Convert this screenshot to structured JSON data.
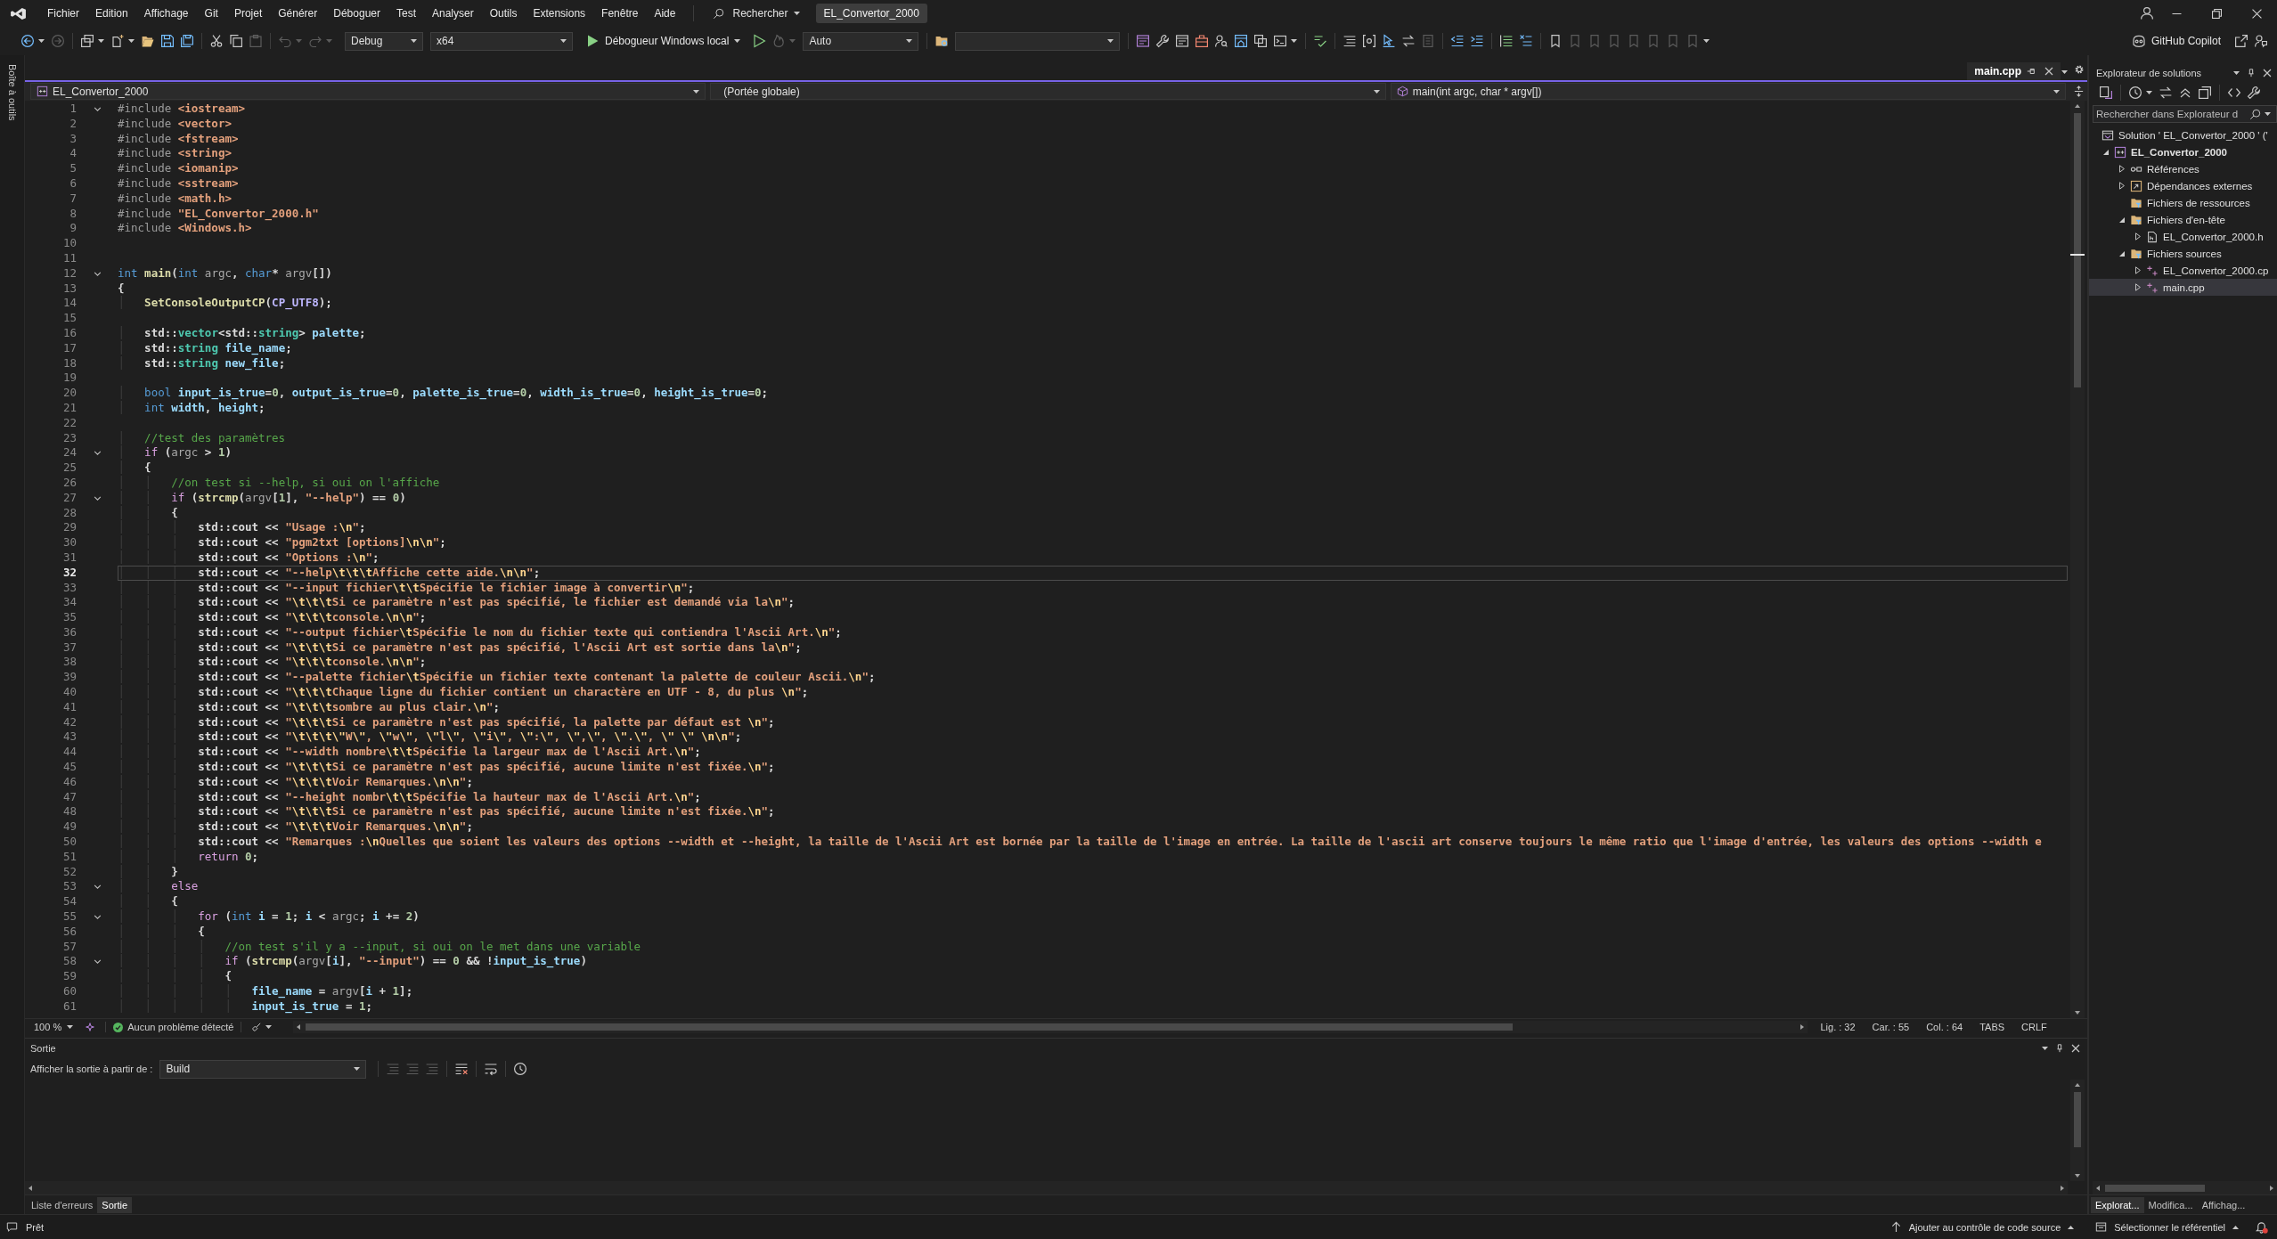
{
  "menu_bar": {
    "items": [
      "Fichier",
      "Edition",
      "Affichage",
      "Git",
      "Projet",
      "Générer",
      "Déboguer",
      "Test",
      "Analyser",
      "Outils",
      "Extensions",
      "Fenêtre",
      "Aide"
    ],
    "search": "Rechercher",
    "solution_name": "EL_Convertor_2000"
  },
  "toolbar": {
    "configuration": "Debug",
    "platform": "x64",
    "start": "Débogueur Windows local",
    "mode": "Auto",
    "copilot": "GitHub Copilot"
  },
  "side_strip": {
    "label": "Boîte à outils"
  },
  "editor": {
    "tabs": [
      {
        "label": "main.cpp",
        "selected": true
      }
    ],
    "navigation": {
      "project": "EL_Convertor_2000",
      "scope": "(Portée globale)",
      "member": "main(int argc, char * argv[])"
    },
    "lines": [
      {
        "number": "1",
        "fold": true,
        "current": false,
        "tokens": [
          {
            "kind": "preproc",
            "text": "#include "
          },
          {
            "kind": "include",
            "text": "<iostream>"
          }
        ]
      },
      {
        "number": "2",
        "fold": false,
        "current": false,
        "tokens": [
          {
            "kind": "preproc",
            "text": "#include "
          },
          {
            "kind": "include",
            "text": "<vector>"
          }
        ]
      },
      {
        "number": "3",
        "fold": false,
        "current": false,
        "tokens": [
          {
            "kind": "preproc",
            "text": "#include "
          },
          {
            "kind": "include",
            "text": "<fstream>"
          }
        ]
      },
      {
        "number": "4",
        "fold": false,
        "current": false,
        "tokens": [
          {
            "kind": "preproc",
            "text": "#include "
          },
          {
            "kind": "include",
            "text": "<string>"
          }
        ]
      },
      {
        "number": "5",
        "fold": false,
        "current": false,
        "tokens": [
          {
            "kind": "preproc",
            "text": "#include "
          },
          {
            "kind": "include",
            "text": "<iomanip>"
          }
        ]
      },
      {
        "number": "6",
        "fold": false,
        "current": false,
        "tokens": [
          {
            "kind": "preproc",
            "text": "#include "
          },
          {
            "kind": "include",
            "text": "<sstream>"
          }
        ]
      },
      {
        "number": "7",
        "fold": false,
        "current": false,
        "tokens": [
          {
            "kind": "preproc",
            "text": "#include "
          },
          {
            "kind": "include",
            "text": "<math.h>"
          }
        ]
      },
      {
        "number": "8",
        "fold": false,
        "current": false,
        "tokens": [
          {
            "kind": "preproc",
            "text": "#include "
          },
          {
            "kind": "include",
            "text": "\"EL_Convertor_2000.h\""
          }
        ]
      },
      {
        "number": "9",
        "fold": false,
        "current": false,
        "tokens": [
          {
            "kind": "preproc",
            "text": "#include "
          },
          {
            "kind": "include",
            "text": "<Windows.h>"
          }
        ]
      },
      {
        "number": "10",
        "fold": false,
        "current": false
      },
      {
        "number": "11",
        "fold": false,
        "current": false
      },
      {
        "number": "12",
        "fold": true,
        "current": false,
        "tokens": [
          {
            "kind": "kw",
            "text": "int "
          },
          {
            "kind": "fn",
            "text": "main"
          },
          {
            "kind": "plain",
            "text": "("
          },
          {
            "kind": "kw",
            "text": "int "
          },
          {
            "kind": "param",
            "text": "argc"
          },
          {
            "kind": "plain",
            "text": ", "
          },
          {
            "kind": "kw",
            "text": "char"
          },
          {
            "kind": "plain",
            "text": "* "
          },
          {
            "kind": "param",
            "text": "argv"
          },
          {
            "kind": "plain",
            "text": "[])"
          }
        ]
      },
      {
        "number": "13",
        "fold": false,
        "current": false,
        "tokens": [
          {
            "kind": "plain",
            "text": "{"
          }
        ]
      },
      {
        "number": "14",
        "fold": false,
        "current": false,
        "tokens": [
          {
            "kind": "fn",
            "text": "\tSetConsoleOutputCP"
          },
          {
            "kind": "plain",
            "text": "("
          },
          {
            "kind": "macro",
            "text": "CP_UTF8"
          },
          {
            "kind": "plain",
            "text": ");"
          }
        ]
      },
      {
        "number": "15",
        "fold": false,
        "current": false
      },
      {
        "number": "16",
        "fold": false,
        "current": false,
        "tokens": [
          {
            "kind": "plain",
            "text": "\tstd::"
          },
          {
            "kind": "type",
            "text": "vector"
          },
          {
            "kind": "plain",
            "text": "<std::"
          },
          {
            "kind": "type",
            "text": "string"
          },
          {
            "kind": "plain",
            "text": "> "
          },
          {
            "kind": "var",
            "text": "palette"
          },
          {
            "kind": "plain",
            "text": ";"
          }
        ]
      },
      {
        "number": "17",
        "fold": false,
        "current": false,
        "tokens": [
          {
            "kind": "plain",
            "text": "\tstd::"
          },
          {
            "kind": "type",
            "text": "string"
          },
          {
            "kind": "var",
            "text": " file_name"
          },
          {
            "kind": "plain",
            "text": ";"
          }
        ]
      },
      {
        "number": "18",
        "fold": false,
        "current": false,
        "tokens": [
          {
            "kind": "plain",
            "text": "\tstd::"
          },
          {
            "kind": "type",
            "text": "string"
          },
          {
            "kind": "var",
            "text": " new_file"
          },
          {
            "kind": "plain",
            "text": ";"
          }
        ]
      },
      {
        "number": "19",
        "fold": false,
        "current": false
      },
      {
        "number": "20",
        "fold": false,
        "current": false,
        "tokens": [
          {
            "kind": "kw",
            "text": "\tbool "
          },
          {
            "kind": "var",
            "text": "input_is_true"
          },
          {
            "kind": "plain",
            "text": "="
          },
          {
            "kind": "num",
            "text": "0"
          },
          {
            "kind": "plain",
            "text": ", "
          },
          {
            "kind": "var",
            "text": "output_is_true"
          },
          {
            "kind": "plain",
            "text": "="
          },
          {
            "kind": "num",
            "text": "0"
          },
          {
            "kind": "plain",
            "text": ", "
          },
          {
            "kind": "var",
            "text": "palette_is_true"
          },
          {
            "kind": "plain",
            "text": "="
          },
          {
            "kind": "num",
            "text": "0"
          },
          {
            "kind": "plain",
            "text": ", "
          },
          {
            "kind": "var",
            "text": "width_is_true"
          },
          {
            "kind": "plain",
            "text": "="
          },
          {
            "kind": "num",
            "text": "0"
          },
          {
            "kind": "plain",
            "text": ", "
          },
          {
            "kind": "var",
            "text": "height_is_true"
          },
          {
            "kind": "plain",
            "text": "="
          },
          {
            "kind": "num",
            "text": "0"
          },
          {
            "kind": "plain",
            "text": ";"
          }
        ]
      },
      {
        "number": "21",
        "fold": false,
        "current": false,
        "tokens": [
          {
            "kind": "kw",
            "text": "\tint "
          },
          {
            "kind": "var",
            "text": "width"
          },
          {
            "kind": "plain",
            "text": ", "
          },
          {
            "kind": "var",
            "text": "height"
          },
          {
            "kind": "plain",
            "text": ";"
          }
        ]
      },
      {
        "number": "22",
        "fold": false,
        "current": false
      },
      {
        "number": "23",
        "fold": false,
        "current": false,
        "tokens": [
          {
            "kind": "cmt",
            "text": "\t//test des paramètres"
          }
        ]
      },
      {
        "number": "24",
        "fold": true,
        "current": false,
        "tokens": [
          {
            "kind": "ctl",
            "text": "\tif"
          },
          {
            "kind": "plain",
            "text": " ("
          },
          {
            "kind": "param",
            "text": "argc"
          },
          {
            "kind": "plain",
            "text": " > "
          },
          {
            "kind": "num",
            "text": "1"
          },
          {
            "kind": "plain",
            "text": ")"
          }
        ]
      },
      {
        "number": "25",
        "fold": false,
        "current": false,
        "tokens": [
          {
            "kind": "plain",
            "text": "\t{"
          }
        ]
      },
      {
        "number": "26",
        "fold": false,
        "current": false,
        "tokens": [
          {
            "kind": "cmt",
            "text": "\t\t//on test si --help, si oui on l'affiche"
          }
        ]
      },
      {
        "number": "27",
        "fold": true,
        "current": false,
        "tokens": [
          {
            "kind": "ctl",
            "text": "\t\tif"
          },
          {
            "kind": "plain",
            "text": " ("
          },
          {
            "kind": "fn",
            "text": "strcmp"
          },
          {
            "kind": "plain",
            "text": "("
          },
          {
            "kind": "param",
            "text": "argv"
          },
          {
            "kind": "plain",
            "text": "["
          },
          {
            "kind": "num",
            "text": "1"
          },
          {
            "kind": "plain",
            "text": "], "
          },
          {
            "kind": "str",
            "text": "\"--help\""
          },
          {
            "kind": "plain",
            "text": ") == "
          },
          {
            "kind": "num",
            "text": "0"
          },
          {
            "kind": "plain",
            "text": ")"
          }
        ]
      },
      {
        "number": "28",
        "fold": false,
        "current": false,
        "tokens": [
          {
            "kind": "plain",
            "text": "\t\t{"
          }
        ]
      },
      {
        "number": "29",
        "fold": false,
        "current": false,
        "tokens": [
          {
            "kind": "plain",
            "text": "\t\t\tstd::cout << "
          },
          {
            "kind": "str",
            "text": "\"Usage :"
          },
          {
            "kind": "esc",
            "text": "\\n"
          },
          {
            "kind": "str",
            "text": "\""
          },
          {
            "kind": "plain",
            "text": ";"
          }
        ]
      },
      {
        "number": "30",
        "fold": false,
        "current": false,
        "tokens": [
          {
            "kind": "plain",
            "text": "\t\t\tstd::cout << "
          },
          {
            "kind": "str",
            "text": "\"pgm2txt [options]"
          },
          {
            "kind": "esc",
            "text": "\\n\\n"
          },
          {
            "kind": "str",
            "text": "\""
          },
          {
            "kind": "plain",
            "text": ";"
          }
        ]
      },
      {
        "number": "31",
        "fold": false,
        "current": false,
        "tokens": [
          {
            "kind": "plain",
            "text": "\t\t\tstd::cout << "
          },
          {
            "kind": "str",
            "text": "\"Options :"
          },
          {
            "kind": "esc",
            "text": "\\n"
          },
          {
            "kind": "str",
            "text": "\""
          },
          {
            "kind": "plain",
            "text": ";"
          }
        ]
      },
      {
        "number": "32",
        "fold": false,
        "current": true,
        "tokens": [
          {
            "kind": "plain",
            "text": "\t\t\tstd::cout << "
          },
          {
            "kind": "str",
            "text": "\"--help"
          },
          {
            "kind": "esc",
            "text": "\\t\\t\\t"
          },
          {
            "kind": "str",
            "text": "Affiche cette aide."
          },
          {
            "kind": "esc",
            "text": "\\n\\n"
          },
          {
            "kind": "str",
            "text": "\""
          },
          {
            "kind": "plain",
            "text": ";"
          }
        ]
      },
      {
        "number": "33",
        "fold": false,
        "current": false,
        "tokens": [
          {
            "kind": "plain",
            "text": "\t\t\tstd::cout << "
          },
          {
            "kind": "str",
            "text": "\"--input fichier"
          },
          {
            "kind": "esc",
            "text": "\\t\\t"
          },
          {
            "kind": "str",
            "text": "Spécifie le fichier image à convertir"
          },
          {
            "kind": "esc",
            "text": "\\n"
          },
          {
            "kind": "str",
            "text": "\""
          },
          {
            "kind": "plain",
            "text": ";"
          }
        ]
      },
      {
        "number": "34",
        "fold": false,
        "current": false,
        "tokens": [
          {
            "kind": "plain",
            "text": "\t\t\tstd::cout << "
          },
          {
            "kind": "str",
            "text": "\""
          },
          {
            "kind": "esc",
            "text": "\\t\\t\\t"
          },
          {
            "kind": "str",
            "text": "Si ce paramètre n'est pas spécifié, le fichier est demandé via la"
          },
          {
            "kind": "esc",
            "text": "\\n"
          },
          {
            "kind": "str",
            "text": "\""
          },
          {
            "kind": "plain",
            "text": ";"
          }
        ]
      },
      {
        "number": "35",
        "fold": false,
        "current": false,
        "tokens": [
          {
            "kind": "plain",
            "text": "\t\t\tstd::cout << "
          },
          {
            "kind": "str",
            "text": "\""
          },
          {
            "kind": "esc",
            "text": "\\t\\t\\t"
          },
          {
            "kind": "str",
            "text": "console."
          },
          {
            "kind": "esc",
            "text": "\\n\\n"
          },
          {
            "kind": "str",
            "text": "\""
          },
          {
            "kind": "plain",
            "text": ";"
          }
        ]
      },
      {
        "number": "36",
        "fold": false,
        "current": false,
        "tokens": [
          {
            "kind": "plain",
            "text": "\t\t\tstd::cout << "
          },
          {
            "kind": "str",
            "text": "\"--output fichier"
          },
          {
            "kind": "esc",
            "text": "\\t"
          },
          {
            "kind": "str",
            "text": "Spécifie le nom du fichier texte qui contiendra l'Ascii Art."
          },
          {
            "kind": "esc",
            "text": "\\n"
          },
          {
            "kind": "str",
            "text": "\""
          },
          {
            "kind": "plain",
            "text": ";"
          }
        ]
      },
      {
        "number": "37",
        "fold": false,
        "current": false,
        "tokens": [
          {
            "kind": "plain",
            "text": "\t\t\tstd::cout << "
          },
          {
            "kind": "str",
            "text": "\""
          },
          {
            "kind": "esc",
            "text": "\\t\\t\\t"
          },
          {
            "kind": "str",
            "text": "Si ce paramètre n'est pas spécifié, l'Ascii Art est sortie dans la"
          },
          {
            "kind": "esc",
            "text": "\\n"
          },
          {
            "kind": "str",
            "text": "\""
          },
          {
            "kind": "plain",
            "text": ";"
          }
        ]
      },
      {
        "number": "38",
        "fold": false,
        "current": false,
        "tokens": [
          {
            "kind": "plain",
            "text": "\t\t\tstd::cout << "
          },
          {
            "kind": "str",
            "text": "\""
          },
          {
            "kind": "esc",
            "text": "\\t\\t\\t"
          },
          {
            "kind": "str",
            "text": "console."
          },
          {
            "kind": "esc",
            "text": "\\n\\n"
          },
          {
            "kind": "str",
            "text": "\""
          },
          {
            "kind": "plain",
            "text": ";"
          }
        ]
      },
      {
        "number": "39",
        "fold": false,
        "current": false,
        "tokens": [
          {
            "kind": "plain",
            "text": "\t\t\tstd::cout << "
          },
          {
            "kind": "str",
            "text": "\"--palette fichier"
          },
          {
            "kind": "esc",
            "text": "\\t"
          },
          {
            "kind": "str",
            "text": "Spécifie un fichier texte contenant la palette de couleur Ascii."
          },
          {
            "kind": "esc",
            "text": "\\n"
          },
          {
            "kind": "str",
            "text": "\""
          },
          {
            "kind": "plain",
            "text": ";"
          }
        ]
      },
      {
        "number": "40",
        "fold": false,
        "current": false,
        "tokens": [
          {
            "kind": "plain",
            "text": "\t\t\tstd::cout << "
          },
          {
            "kind": "str",
            "text": "\""
          },
          {
            "kind": "esc",
            "text": "\\t\\t\\t"
          },
          {
            "kind": "str",
            "text": "Chaque ligne du fichier contient un charactère en UTF - 8, du plus "
          },
          {
            "kind": "esc",
            "text": "\\n"
          },
          {
            "kind": "str",
            "text": "\""
          },
          {
            "kind": "plain",
            "text": ";"
          }
        ]
      },
      {
        "number": "41",
        "fold": false,
        "current": false,
        "tokens": [
          {
            "kind": "plain",
            "text": "\t\t\tstd::cout << "
          },
          {
            "kind": "str",
            "text": "\""
          },
          {
            "kind": "esc",
            "text": "\\t\\t\\t"
          },
          {
            "kind": "str",
            "text": "sombre au plus clair."
          },
          {
            "kind": "esc",
            "text": "\\n"
          },
          {
            "kind": "str",
            "text": "\""
          },
          {
            "kind": "plain",
            "text": ";"
          }
        ]
      },
      {
        "number": "42",
        "fold": false,
        "current": false,
        "tokens": [
          {
            "kind": "plain",
            "text": "\t\t\tstd::cout << "
          },
          {
            "kind": "str",
            "text": "\""
          },
          {
            "kind": "esc",
            "text": "\\t\\t\\t"
          },
          {
            "kind": "str",
            "text": "Si ce paramètre n'est pas spécifié, la palette par défaut est "
          },
          {
            "kind": "esc",
            "text": "\\n"
          },
          {
            "kind": "str",
            "text": "\""
          },
          {
            "kind": "plain",
            "text": ";"
          }
        ]
      },
      {
        "number": "43",
        "fold": false,
        "current": false,
        "tokens": [
          {
            "kind": "plain",
            "text": "\t\t\tstd::cout << "
          },
          {
            "kind": "str",
            "text": "\""
          },
          {
            "kind": "esc",
            "text": "\\t\\t\\t\\\""
          },
          {
            "kind": "str",
            "text": "W"
          },
          {
            "kind": "esc",
            "text": "\\\""
          },
          {
            "kind": "str",
            "text": ", "
          },
          {
            "kind": "esc",
            "text": "\\\""
          },
          {
            "kind": "str",
            "text": "w"
          },
          {
            "kind": "esc",
            "text": "\\\""
          },
          {
            "kind": "str",
            "text": ", "
          },
          {
            "kind": "esc",
            "text": "\\\""
          },
          {
            "kind": "str",
            "text": "l"
          },
          {
            "kind": "esc",
            "text": "\\\""
          },
          {
            "kind": "str",
            "text": ", "
          },
          {
            "kind": "esc",
            "text": "\\\""
          },
          {
            "kind": "str",
            "text": "i"
          },
          {
            "kind": "esc",
            "text": "\\\""
          },
          {
            "kind": "str",
            "text": ", "
          },
          {
            "kind": "esc",
            "text": "\\\""
          },
          {
            "kind": "str",
            "text": ":"
          },
          {
            "kind": "esc",
            "text": "\\\""
          },
          {
            "kind": "str",
            "text": ", "
          },
          {
            "kind": "esc",
            "text": "\\\""
          },
          {
            "kind": "str",
            "text": ","
          },
          {
            "kind": "esc",
            "text": "\\\""
          },
          {
            "kind": "str",
            "text": ", "
          },
          {
            "kind": "esc",
            "text": "\\\""
          },
          {
            "kind": "str",
            "text": "."
          },
          {
            "kind": "esc",
            "text": "\\\""
          },
          {
            "kind": "str",
            "text": ", "
          },
          {
            "kind": "esc",
            "text": "\\\" \\\" \\n\\n"
          },
          {
            "kind": "str",
            "text": "\""
          },
          {
            "kind": "plain",
            "text": ";"
          }
        ]
      },
      {
        "number": "44",
        "fold": false,
        "current": false,
        "tokens": [
          {
            "kind": "plain",
            "text": "\t\t\tstd::cout << "
          },
          {
            "kind": "str",
            "text": "\"--width nombre"
          },
          {
            "kind": "esc",
            "text": "\\t\\t"
          },
          {
            "kind": "str",
            "text": "Spécifie la largeur max de l'Ascii Art."
          },
          {
            "kind": "esc",
            "text": "\\n"
          },
          {
            "kind": "str",
            "text": "\""
          },
          {
            "kind": "plain",
            "text": ";"
          }
        ]
      },
      {
        "number": "45",
        "fold": false,
        "current": false,
        "tokens": [
          {
            "kind": "plain",
            "text": "\t\t\tstd::cout << "
          },
          {
            "kind": "str",
            "text": "\""
          },
          {
            "kind": "esc",
            "text": "\\t\\t\\t"
          },
          {
            "kind": "str",
            "text": "Si ce paramètre n'est pas spécifié, aucune limite n'est fixée."
          },
          {
            "kind": "esc",
            "text": "\\n"
          },
          {
            "kind": "str",
            "text": "\""
          },
          {
            "kind": "plain",
            "text": ";"
          }
        ]
      },
      {
        "number": "46",
        "fold": false,
        "current": false,
        "tokens": [
          {
            "kind": "plain",
            "text": "\t\t\tstd::cout << "
          },
          {
            "kind": "str",
            "text": "\""
          },
          {
            "kind": "esc",
            "text": "\\t\\t\\t"
          },
          {
            "kind": "str",
            "text": "Voir Remarques."
          },
          {
            "kind": "esc",
            "text": "\\n\\n"
          },
          {
            "kind": "str",
            "text": "\""
          },
          {
            "kind": "plain",
            "text": ";"
          }
        ]
      },
      {
        "number": "47",
        "fold": false,
        "current": false,
        "tokens": [
          {
            "kind": "plain",
            "text": "\t\t\tstd::cout << "
          },
          {
            "kind": "str",
            "text": "\"--height nombr"
          },
          {
            "kind": "esc",
            "text": "\\t\\t"
          },
          {
            "kind": "str",
            "text": "Spécifie la hauteur max de l'Ascii Art."
          },
          {
            "kind": "esc",
            "text": "\\n"
          },
          {
            "kind": "str",
            "text": "\""
          },
          {
            "kind": "plain",
            "text": ";"
          }
        ]
      },
      {
        "number": "48",
        "fold": false,
        "current": false,
        "tokens": [
          {
            "kind": "plain",
            "text": "\t\t\tstd::cout << "
          },
          {
            "kind": "str",
            "text": "\""
          },
          {
            "kind": "esc",
            "text": "\\t\\t\\t"
          },
          {
            "kind": "str",
            "text": "Si ce paramètre n'est pas spécifié, aucune limite n'est fixée."
          },
          {
            "kind": "esc",
            "text": "\\n"
          },
          {
            "kind": "str",
            "text": "\""
          },
          {
            "kind": "plain",
            "text": ";"
          }
        ]
      },
      {
        "number": "49",
        "fold": false,
        "current": false,
        "tokens": [
          {
            "kind": "plain",
            "text": "\t\t\tstd::cout << "
          },
          {
            "kind": "str",
            "text": "\""
          },
          {
            "kind": "esc",
            "text": "\\t\\t\\t"
          },
          {
            "kind": "str",
            "text": "Voir Remarques."
          },
          {
            "kind": "esc",
            "text": "\\n\\n"
          },
          {
            "kind": "str",
            "text": "\""
          },
          {
            "kind": "plain",
            "text": ";"
          }
        ]
      },
      {
        "number": "50",
        "fold": false,
        "current": false,
        "tokens": [
          {
            "kind": "plain",
            "text": "\t\t\tstd::cout << "
          },
          {
            "kind": "str",
            "text": "\"Remarques :"
          },
          {
            "kind": "esc",
            "text": "\\n"
          },
          {
            "kind": "str",
            "text": "Quelles que soient les valeurs des options --width et --height, la taille de l'Ascii Art est bornée par la taille de l'image en entrée. La taille de l'ascii art conserve toujours le même ratio que l'image d'entrée, les valeurs des options --width e"
          }
        ]
      },
      {
        "number": "51",
        "fold": false,
        "current": false,
        "tokens": [
          {
            "kind": "ctl",
            "text": "\t\t\treturn "
          },
          {
            "kind": "num",
            "text": "0"
          },
          {
            "kind": "plain",
            "text": ";"
          }
        ]
      },
      {
        "number": "52",
        "fold": false,
        "current": false,
        "tokens": [
          {
            "kind": "plain",
            "text": "\t\t}"
          }
        ]
      },
      {
        "number": "53",
        "fold": true,
        "current": false,
        "tokens": [
          {
            "kind": "ctl",
            "text": "\t\telse"
          }
        ]
      },
      {
        "number": "54",
        "fold": false,
        "current": false,
        "tokens": [
          {
            "kind": "plain",
            "text": "\t\t{"
          }
        ]
      },
      {
        "number": "55",
        "fold": true,
        "current": false,
        "tokens": [
          {
            "kind": "ctl",
            "text": "\t\t\tfor"
          },
          {
            "kind": "plain",
            "text": " ("
          },
          {
            "kind": "kw",
            "text": "int "
          },
          {
            "kind": "var",
            "text": "i"
          },
          {
            "kind": "plain",
            "text": " = "
          },
          {
            "kind": "num",
            "text": "1"
          },
          {
            "kind": "plain",
            "text": "; "
          },
          {
            "kind": "var",
            "text": "i"
          },
          {
            "kind": "plain",
            "text": " < "
          },
          {
            "kind": "param",
            "text": "argc"
          },
          {
            "kind": "plain",
            "text": "; "
          },
          {
            "kind": "var",
            "text": "i"
          },
          {
            "kind": "plain",
            "text": " += "
          },
          {
            "kind": "num",
            "text": "2"
          },
          {
            "kind": "plain",
            "text": ")"
          }
        ]
      },
      {
        "number": "56",
        "fold": false,
        "current": false,
        "tokens": [
          {
            "kind": "plain",
            "text": "\t\t\t{"
          }
        ]
      },
      {
        "number": "57",
        "fold": false,
        "current": false,
        "tokens": [
          {
            "kind": "cmt",
            "text": "\t\t\t\t//on test s'il y a --input, si oui on le met dans une variable"
          }
        ]
      },
      {
        "number": "58",
        "fold": true,
        "current": false,
        "tokens": [
          {
            "kind": "ctl",
            "text": "\t\t\t\tif"
          },
          {
            "kind": "plain",
            "text": " ("
          },
          {
            "kind": "fn",
            "text": "strcmp"
          },
          {
            "kind": "plain",
            "text": "("
          },
          {
            "kind": "param",
            "text": "argv"
          },
          {
            "kind": "plain",
            "text": "["
          },
          {
            "kind": "var",
            "text": "i"
          },
          {
            "kind": "plain",
            "text": "], "
          },
          {
            "kind": "str",
            "text": "\"--input\""
          },
          {
            "kind": "plain",
            "text": ") == "
          },
          {
            "kind": "num",
            "text": "0"
          },
          {
            "kind": "plain",
            "text": " && !"
          },
          {
            "kind": "var",
            "text": "input_is_true"
          },
          {
            "kind": "plain",
            "text": ")"
          }
        ]
      },
      {
        "number": "59",
        "fold": false,
        "current": false,
        "tokens": [
          {
            "kind": "plain",
            "text": "\t\t\t\t{"
          }
        ]
      },
      {
        "number": "60",
        "fold": false,
        "current": false,
        "tokens": [
          {
            "kind": "var",
            "text": "\t\t\t\t\tfile_name"
          },
          {
            "kind": "plain",
            "text": " = "
          },
          {
            "kind": "param",
            "text": "argv"
          },
          {
            "kind": "plain",
            "text": "["
          },
          {
            "kind": "var",
            "text": "i"
          },
          {
            "kind": "plain",
            "text": " + "
          },
          {
            "kind": "num",
            "text": "1"
          },
          {
            "kind": "plain",
            "text": "];"
          }
        ]
      },
      {
        "number": "61",
        "fold": false,
        "current": false,
        "tokens": [
          {
            "kind": "var",
            "text": "\t\t\t\t\tinput_is_true"
          },
          {
            "kind": "plain",
            "text": " = "
          },
          {
            "kind": "num",
            "text": "1"
          },
          {
            "kind": "plain",
            "text": ";"
          }
        ]
      }
    ]
  },
  "editor_status": {
    "zoom": "100 %",
    "issues": "Aucun problème détecté",
    "line": "Lig. : 32",
    "char": "Car. : 55",
    "column": "Col. : 64",
    "indent": "TABS",
    "line_endings": "CRLF"
  },
  "output": {
    "title": "Sortie",
    "source_label": "Afficher la sortie à partir de :",
    "source": "Build"
  },
  "panel_tabs": [
    {
      "label": "Liste d'erreurs",
      "selected": false
    },
    {
      "label": "Sortie",
      "selected": true
    }
  ],
  "solution_explorer": {
    "title": "Explorateur de solutions",
    "search": {
      "placeholder": "Rechercher dans Explorateur d"
    },
    "tree": [
      {
        "label": "Solution ' EL_Convertor_2000 ' ('",
        "kind": "solution",
        "selected": false,
        "children": [
          {
            "label": "EL_Convertor_2000",
            "kind": "project",
            "expanded": true,
            "selected": false,
            "children": [
              {
                "label": "Références",
                "kind": "references",
                "expanded": false,
                "selected": false
              },
              {
                "label": "Dépendances externes",
                "kind": "dependencies",
                "expanded": false,
                "selected": false
              },
              {
                "label": "Fichiers de ressources",
                "kind": "filter",
                "selected": false
              },
              {
                "label": "Fichiers d'en-tête",
                "kind": "filter",
                "expanded": true,
                "selected": false,
                "children": [
                  {
                    "label": "EL_Convertor_2000.h",
                    "kind": "header",
                    "expanded": false,
                    "selected": false
                  }
                ]
              },
              {
                "label": "Fichiers sources",
                "kind": "filter",
                "expanded": true,
                "selected": false,
                "children": [
                  {
                    "label": "EL_Convertor_2000.cp",
                    "kind": "source",
                    "expanded": false,
                    "selected": false
                  },
                  {
                    "label": "main.cpp",
                    "kind": "source",
                    "expanded": false,
                    "selected": true
                  }
                ]
              }
            ]
          }
        ]
      }
    ],
    "tabs": [
      {
        "label": "Explorat...",
        "selected": true
      },
      {
        "label": "Modifica...",
        "selected": false
      },
      {
        "label": "Affichag...",
        "selected": false
      }
    ]
  },
  "status_bar": {
    "status": "Prêt",
    "source_control": "Ajouter au contrôle de code source",
    "repository": "Sélectionner le référentiel"
  }
}
